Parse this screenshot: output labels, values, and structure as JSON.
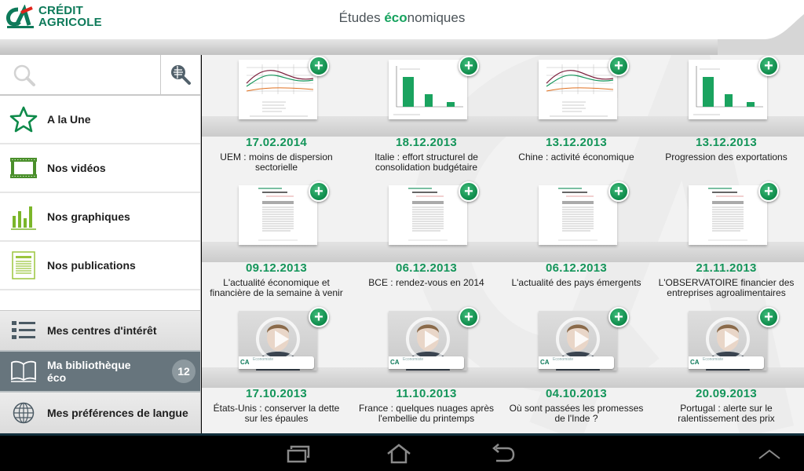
{
  "app": {
    "logo_line1": "CRÉDIT",
    "logo_line2": "AGRICOLE",
    "title_part1": "Études ",
    "title_part2": "éco",
    "title_part3": "nomiques",
    "brand_color": "#0e7a5a",
    "accent_color": "#14955a"
  },
  "search": {
    "value": "",
    "placeholder": "",
    "icon": "search-icon",
    "advanced_icon": "advanced-search-icon"
  },
  "sidebar": {
    "items": [
      {
        "label": "A la Une",
        "icon": "star-icon"
      },
      {
        "label": "Nos vidéos",
        "icon": "film-icon"
      },
      {
        "label": "Nos graphiques",
        "icon": "bar-chart-icon"
      },
      {
        "label": "Nos publications",
        "icon": "document-icon"
      }
    ],
    "bottom_items": [
      {
        "label": "Mes centres d'intérêt",
        "icon": "list-icon"
      },
      {
        "label_line1": "Ma bibliothèque",
        "label_line2": "éco",
        "icon": "book-icon",
        "badge": "12",
        "active": true
      },
      {
        "label": "Mes préférences de langue",
        "icon": "globe-icon"
      }
    ]
  },
  "cards": [
    {
      "date": "17.02.2014",
      "caption": "UEM : moins de dispersion sectorielle",
      "type": "line-chart"
    },
    {
      "date": "18.12.2013",
      "caption": "Italie : effort structurel de consolidation budgétaire",
      "type": "bar-chart"
    },
    {
      "date": "13.12.2013",
      "caption": "Chine : activité économique",
      "type": "line-chart"
    },
    {
      "date": "13.12.2013",
      "caption": "Progression des exportations",
      "type": "bar-chart"
    },
    {
      "date": "09.12.2013",
      "caption": "L'actualité économique et financière de la semaine à venir",
      "type": "publication"
    },
    {
      "date": "06.12.2013",
      "caption": "BCE : rendez-vous en 2014",
      "type": "publication"
    },
    {
      "date": "06.12.2013",
      "caption": "L'actualité des pays émergents",
      "type": "publication"
    },
    {
      "date": "21.11.2013",
      "caption": "L'OBSERVATOIRE financier des entreprises agroalimentaires",
      "type": "publication"
    },
    {
      "date": "17.10.2013",
      "caption": "États-Unis : conserver la dette sur les épaules",
      "type": "video",
      "presenter_role": "Economiste"
    },
    {
      "date": "11.10.2013",
      "caption": "France : quelques nuages après l'embellie du printemps",
      "type": "video",
      "presenter_role": "Economiste"
    },
    {
      "date": "04.10.2013",
      "caption": "Où sont passées les promesses de l'Inde ?",
      "type": "video",
      "presenter_role": "Economiste"
    },
    {
      "date": "20.09.2013",
      "caption": "Portugal : alerte sur le ralentissement des prix",
      "type": "video",
      "presenter_role": "Economiste"
    }
  ],
  "add_button_label": "+",
  "sysbar": {
    "buttons": [
      "recent-apps",
      "home",
      "back",
      "menu-up"
    ]
  }
}
